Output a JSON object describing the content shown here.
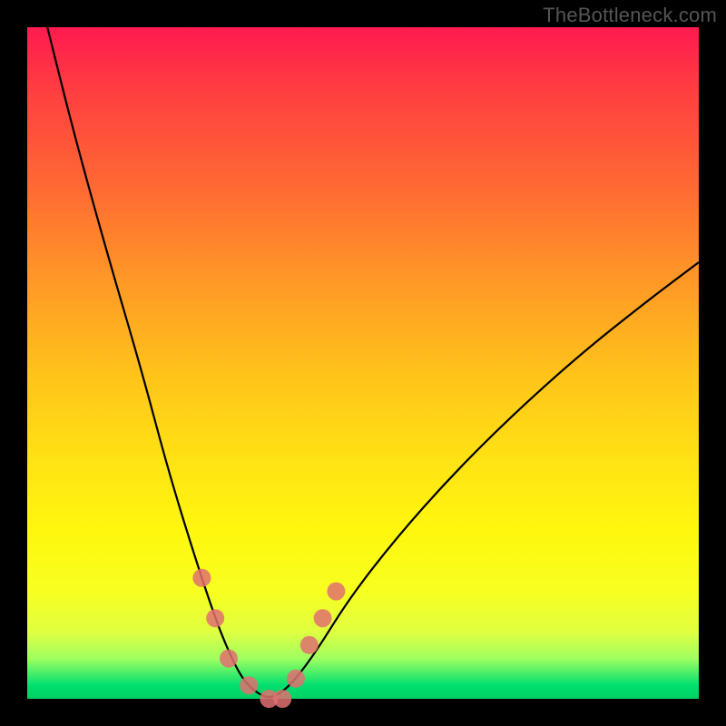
{
  "watermark_text": "TheBottleneck.com",
  "chart_data": {
    "type": "line",
    "title": "",
    "xlabel": "",
    "ylabel": "",
    "xlim": [
      0,
      100
    ],
    "ylim": [
      0,
      100
    ],
    "series": [
      {
        "name": "bottleneck-curve",
        "x": [
          3,
          7,
          12,
          17,
          21,
          25,
          28,
          30,
          32,
          34,
          36,
          38,
          40,
          43,
          48,
          55,
          63,
          72,
          82,
          92,
          100
        ],
        "y": [
          100,
          84,
          66,
          49,
          34,
          21,
          12,
          7,
          3,
          1,
          0,
          1,
          3,
          7,
          15,
          24,
          33,
          42,
          51,
          59,
          65
        ]
      }
    ],
    "markers": {
      "name": "highlighted-points",
      "x": [
        26,
        28,
        30,
        33,
        36,
        38,
        40,
        42,
        44,
        46
      ],
      "y": [
        18,
        12,
        6,
        2,
        0,
        0,
        3,
        8,
        12,
        16
      ]
    }
  }
}
